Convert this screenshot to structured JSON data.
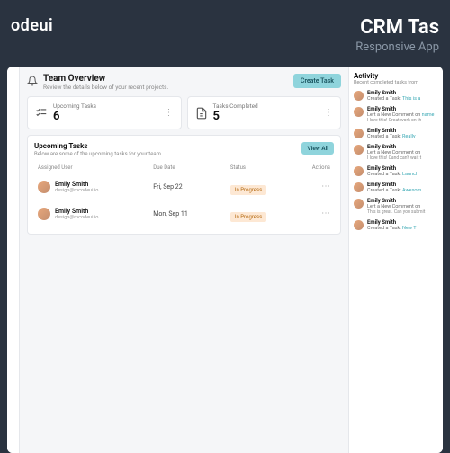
{
  "hero": {
    "logo": "odeui",
    "title": "CRM Tas",
    "subtitle": "Responsive App"
  },
  "header": {
    "title": "Team Overview",
    "subtitle": "Review the details below of your recent projects.",
    "create_btn": "Create Task"
  },
  "stats": [
    {
      "label": "Upcoming Tasks",
      "value": "6"
    },
    {
      "label": "Tasks Completed",
      "value": "5"
    }
  ],
  "tasks": {
    "title": "Upcoming Tasks",
    "subtitle": "Below are some of the upcoming tasks for your team.",
    "view_all": "View All",
    "columns": {
      "user": "Assigned User",
      "due": "Due Date",
      "status": "Status",
      "actions": "Actions"
    },
    "rows": [
      {
        "name": "Emily Smith",
        "email": "design@mcodeui.io",
        "due": "Fri, Sep 22",
        "status": "In Progress"
      },
      {
        "name": "Emily Smith",
        "email": "design@mcodeui.io",
        "due": "Mon, Sep 11",
        "status": "In Progress"
      }
    ]
  },
  "activity": {
    "title": "Activity",
    "subtitle": "Recent completed tasks from",
    "items": [
      {
        "name": "Emily Smith",
        "line": "Created a Task: ",
        "hl": "This is a"
      },
      {
        "name": "Emily Smith",
        "line": "Left a New Comment on ",
        "hl": "name",
        "comment": "I love this! Great work on th"
      },
      {
        "name": "Emily Smith",
        "line": "Created a Task: ",
        "hl": "Really"
      },
      {
        "name": "Emily Smith",
        "line": "Left a New Comment on ",
        "hl": "",
        "comment": "I love this! Cand can't wait t"
      },
      {
        "name": "Emily Smith",
        "line": "Created a Task: ",
        "hl": "Launch"
      },
      {
        "name": "Emily Smith",
        "line": "Created a Task: ",
        "hl": "Awesom"
      },
      {
        "name": "Emily Smith",
        "line": "Left a New Comment on ",
        "hl": "",
        "comment": "This is great. Can you submit"
      },
      {
        "name": "Emily Smith",
        "line": "Created a Task: ",
        "hl": "New T"
      }
    ]
  }
}
